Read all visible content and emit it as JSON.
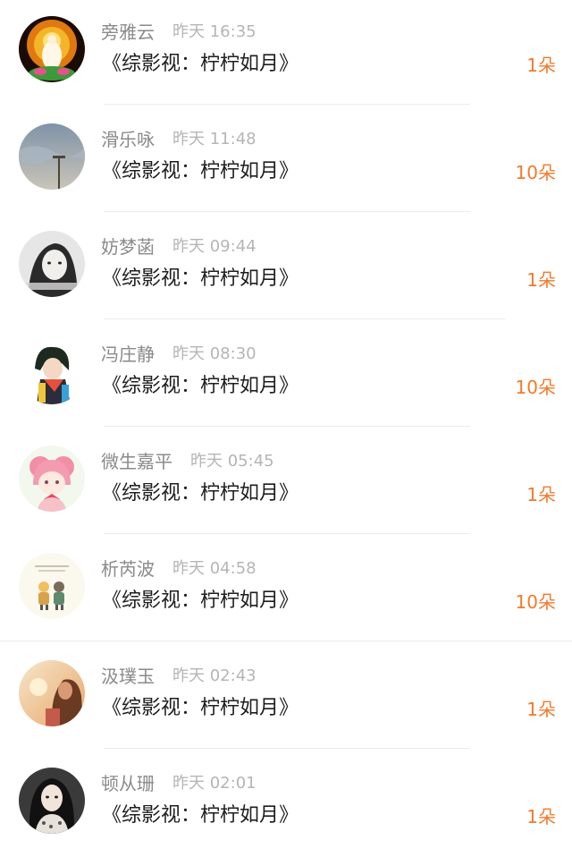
{
  "gifts": [
    {
      "user": "旁雅云",
      "time": "昨天 16:35",
      "book": "《综影视：柠柠如月》",
      "amount": "1朵",
      "avatar_icon": "guanyin-avatar-icon"
    },
    {
      "user": "滑乐咏",
      "time": "昨天 11:48",
      "book": "《综影视：柠柠如月》",
      "amount": "10朵",
      "avatar_icon": "sky-lamp-avatar-icon"
    },
    {
      "user": "妨梦菡",
      "time": "昨天 09:44",
      "book": "《综影视：柠柠如月》",
      "amount": "1朵",
      "avatar_icon": "bw-portrait-avatar-icon"
    },
    {
      "user": "冯庄静",
      "time": "昨天 08:30",
      "book": "《综影视：柠柠如月》",
      "amount": "10朵",
      "avatar_icon": "anime-boy-avatar-icon"
    },
    {
      "user": "微生嘉平",
      "time": "昨天 05:45",
      "book": "《综影视：柠柠如月》",
      "amount": "1朵",
      "avatar_icon": "pink-anime-girl-avatar-icon"
    },
    {
      "user": "析芮波",
      "time": "昨天 04:58",
      "book": "《综影视：柠柠如月》",
      "amount": "10朵",
      "avatar_icon": "cartoon-kids-avatar-icon"
    },
    {
      "user": "汲璞玉",
      "time": "昨天 02:43",
      "book": "《综影视：柠柠如月》",
      "amount": "1朵",
      "avatar_icon": "sunset-girl-avatar-icon"
    },
    {
      "user": "顿从珊",
      "time": "昨天 02:01",
      "book": "《综影视：柠柠如月》",
      "amount": "1朵",
      "avatar_icon": "girl-portrait-avatar-icon"
    }
  ]
}
